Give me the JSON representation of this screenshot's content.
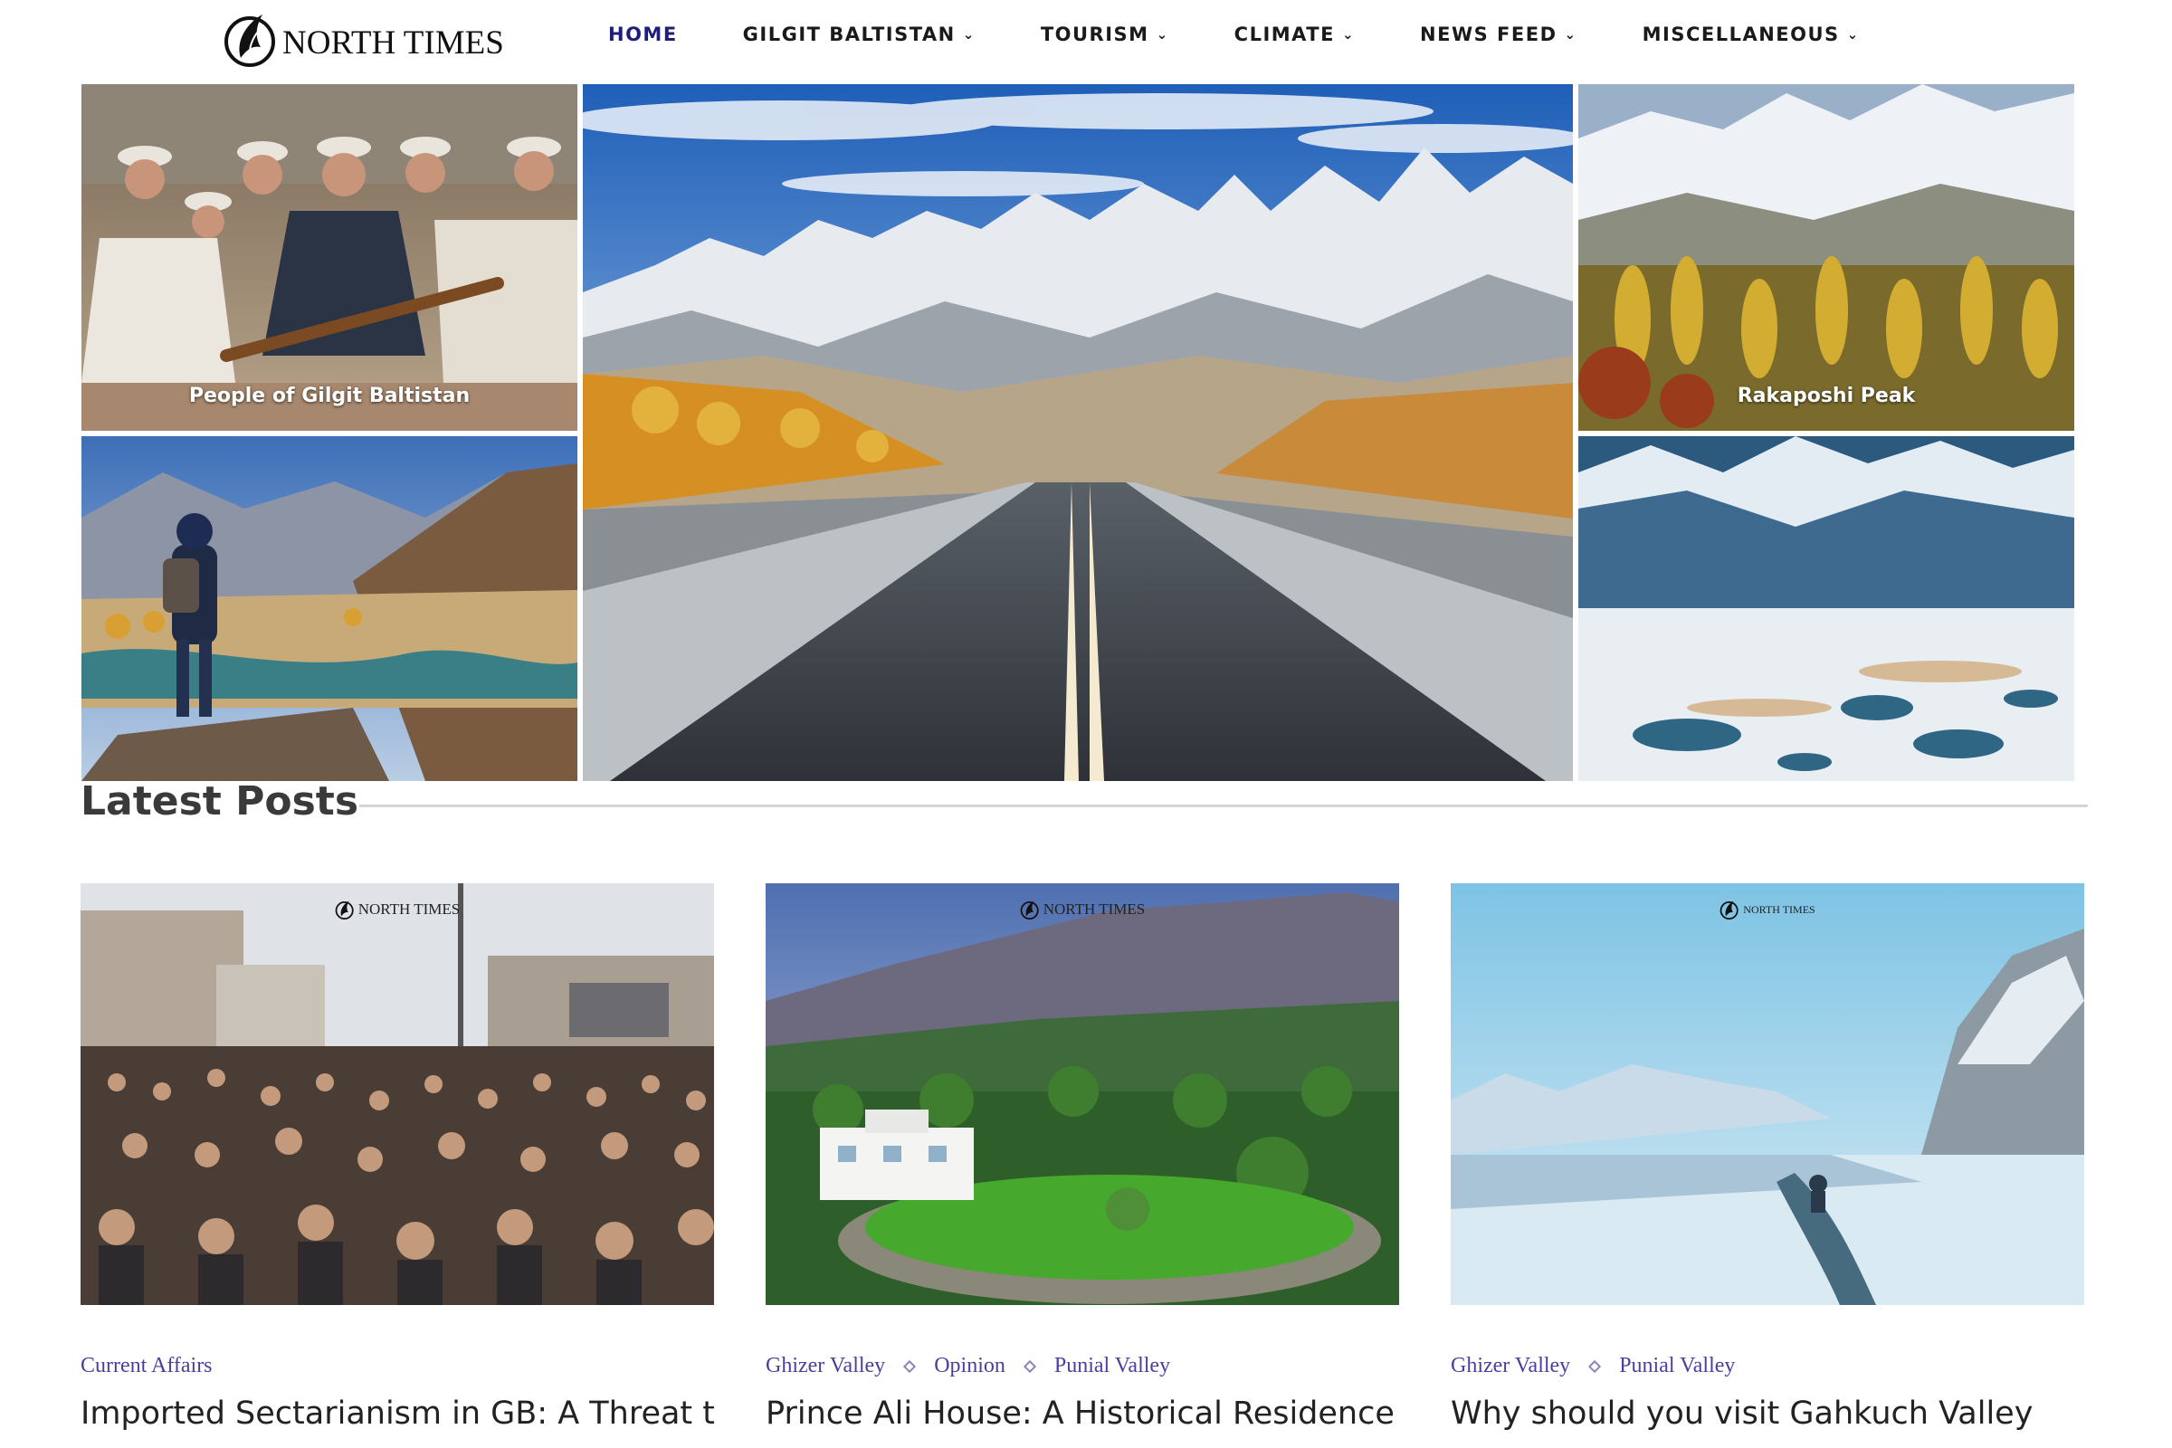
{
  "site": {
    "logo_text": "NORTH TIMES",
    "logo_icon": "north-times-logo-mark"
  },
  "nav": {
    "items": [
      {
        "label": "HOME",
        "active": true,
        "has_dropdown": false
      },
      {
        "label": "GILGIT BALTISTAN",
        "active": false,
        "has_dropdown": true
      },
      {
        "label": "TOURISM",
        "active": false,
        "has_dropdown": true
      },
      {
        "label": "CLIMATE",
        "active": false,
        "has_dropdown": true
      },
      {
        "label": "NEWS FEED",
        "active": false,
        "has_dropdown": true
      },
      {
        "label": "MISCELLANEOUS",
        "active": false,
        "has_dropdown": true
      }
    ],
    "dropdown_icon": "chevron-down-icon"
  },
  "hero": {
    "tiles": [
      {
        "caption": "People of Gilgit Baltistan"
      },
      {
        "caption": ""
      },
      {
        "caption": ""
      },
      {
        "caption": "Rakaposhi Peak"
      },
      {
        "caption": ""
      }
    ]
  },
  "latest": {
    "heading": "Latest Posts",
    "watermark": "NORTH TIMES",
    "posts": [
      {
        "categories": [
          "Current Affairs"
        ],
        "title": "Imported Sectarianism in GB: A Threat to Peaceful"
      },
      {
        "categories": [
          "Ghizer Valley",
          "Opinion",
          "Punial Valley"
        ],
        "title": "Prince Ali House: A Historical Residence in Amphil Gahkuch"
      },
      {
        "categories": [
          "Ghizer Valley",
          "Punial Valley"
        ],
        "title": "Why should you visit Gahkuch Valley"
      }
    ]
  },
  "colors": {
    "nav_active": "#1f1d7a",
    "category_link": "#4b3fa0",
    "heading": "#3a3a3a"
  }
}
